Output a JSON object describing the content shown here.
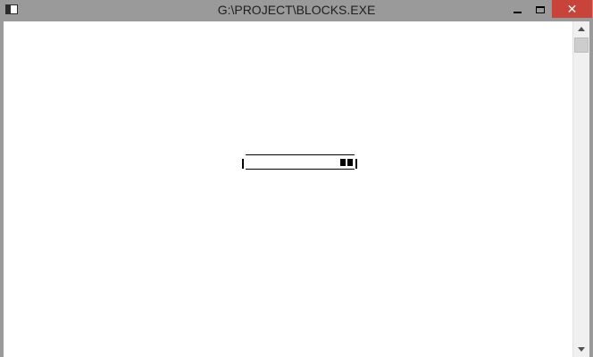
{
  "window": {
    "title": "G:\\PROJECT\\BLOCKS.EXE",
    "close_label": "✕"
  },
  "game": {
    "blocks_shown": 2
  },
  "colors": {
    "titlebar": "#9a9a9a",
    "close_button": "#c8443a",
    "client_background": "#ffffff",
    "drawing": "#000000"
  },
  "icons": {
    "app": "console-window-icon",
    "minimize": "minimize-icon",
    "maximize": "maximize-icon",
    "close": "close-icon",
    "scroll_up": "arrow-up-icon",
    "scroll_down": "arrow-down-icon"
  }
}
